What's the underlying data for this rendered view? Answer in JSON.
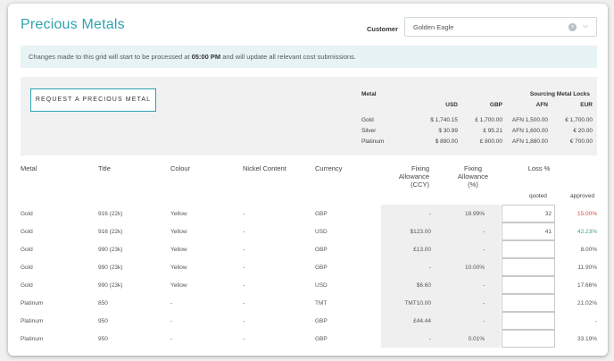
{
  "page": {
    "title": "Precious Metals"
  },
  "customer": {
    "label": "Customer",
    "value": "Golden Eagle",
    "clear_glyph": "×",
    "chevron_glyph": "⌵"
  },
  "banner": {
    "text_before": "Changes made to this grid will start to be processed at ",
    "time": "05:00 PM",
    "text_after": " and will update all relevant cost submissions."
  },
  "request_button": {
    "label": "REQUEST A PRECIOUS METAL"
  },
  "metal_table": {
    "metal_header": "Metal",
    "sourcing_header": "Sourcing Metal Locks",
    "currency_headers": [
      "USD",
      "GBP",
      "AFN",
      "EUR"
    ],
    "rows": [
      {
        "metal": "Gold",
        "values": [
          "$ 1,740.15",
          "£ 1,700.00",
          "AFN 1,500.00",
          "€ 1,700.00"
        ]
      },
      {
        "metal": "Silver",
        "values": [
          "$ 30.99",
          "£ 95.21",
          "AFN 1,600.00",
          "€ 20.00"
        ]
      },
      {
        "metal": "Platinum",
        "values": [
          "$ 890.00",
          "£ 800.00",
          "AFN 1,880.00",
          "€ 700.00"
        ]
      }
    ]
  },
  "grid": {
    "headers": {
      "metal": "Metal",
      "title": "Title",
      "colour": "Colour",
      "nickel": "Nickel Content",
      "currency": "Currency",
      "fixing_line1": "Fixing",
      "fixing_line2": "Allowance",
      "fixing_line3": "(CCY)",
      "fixing_pct_line1": "Fixing",
      "fixing_pct_line2": "Allowance",
      "fixing_pct_line3": "(%)",
      "loss": "Loss %",
      "quoted": "quoted",
      "approved": "approved"
    },
    "rows": [
      {
        "metal": "Gold",
        "title": "916 (22k)",
        "colour": "Yellow",
        "nickel": "-",
        "currency": "GBP",
        "fix_ccy": "-",
        "fix_pct": "18.99%",
        "quoted": "32",
        "approved": "15.00%",
        "approved_color": "#d64545"
      },
      {
        "metal": "Gold",
        "title": "916 (22k)",
        "colour": "Yellow",
        "nickel": "-",
        "currency": "USD",
        "fix_ccy": "$123.00",
        "fix_pct": "-",
        "quoted": "41",
        "approved": "42.23%",
        "approved_color": "#3aa88a"
      },
      {
        "metal": "Gold",
        "title": "990 (23k)",
        "colour": "Yellow",
        "nickel": "-",
        "currency": "GBP",
        "fix_ccy": "£13.00",
        "fix_pct": "-",
        "quoted": "",
        "approved": "8.00%",
        "approved_color": "#555555"
      },
      {
        "metal": "Gold",
        "title": "990 (23k)",
        "colour": "Yellow",
        "nickel": "-",
        "currency": "GBP",
        "fix_ccy": "-",
        "fix_pct": "10.00%",
        "quoted": "",
        "approved": "11.90%",
        "approved_color": "#555555"
      },
      {
        "metal": "Gold",
        "title": "990 (23k)",
        "colour": "Yellow",
        "nickel": "-",
        "currency": "USD",
        "fix_ccy": "$6.60",
        "fix_pct": "-",
        "quoted": "",
        "approved": "17.66%",
        "approved_color": "#555555"
      },
      {
        "metal": "Platinum",
        "title": "850",
        "colour": "-",
        "nickel": "-",
        "currency": "TMT",
        "fix_ccy": "TMT10.00",
        "fix_pct": "-",
        "quoted": "",
        "approved": "21.02%",
        "approved_color": "#555555"
      },
      {
        "metal": "Platinum",
        "title": "950",
        "colour": "-",
        "nickel": "-",
        "currency": "GBP",
        "fix_ccy": "£44.44",
        "fix_pct": "-",
        "quoted": "",
        "approved": "-",
        "approved_color": "#555555"
      },
      {
        "metal": "Platinum",
        "title": "950",
        "colour": "-",
        "nickel": "-",
        "currency": "GBP",
        "fix_ccy": "-",
        "fix_pct": "0.01%",
        "quoted": "",
        "approved": "33.19%",
        "approved_color": "#555555"
      }
    ]
  },
  "colors": {
    "accent": "#2fa3ae",
    "banner_bg": "#e8f3f6",
    "panel_bg": "#f1f1f1",
    "negative": "#d64545",
    "positive": "#3aa88a"
  }
}
